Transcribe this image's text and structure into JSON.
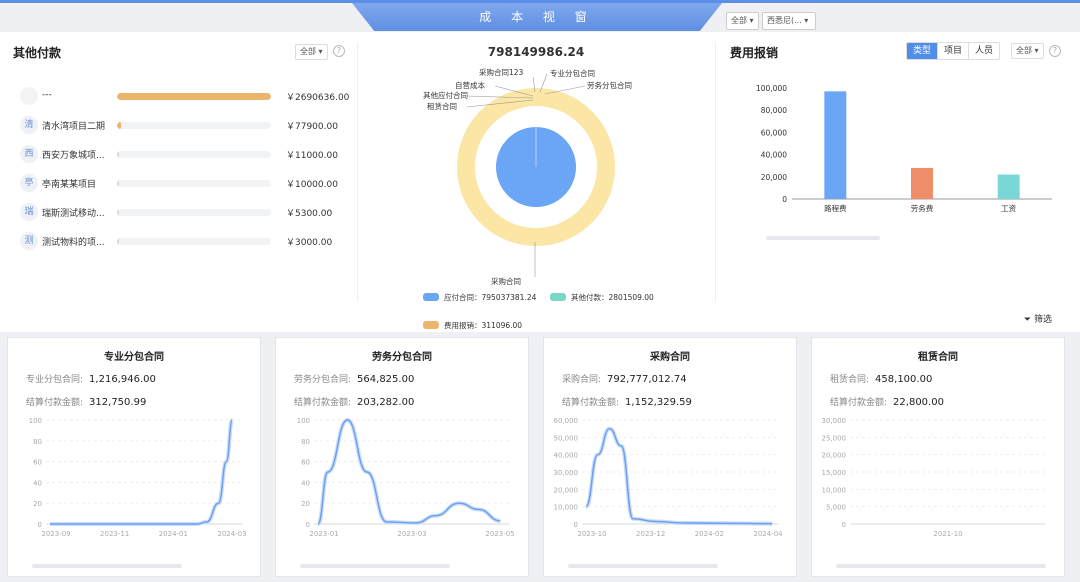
{
  "banner": "成 本 视 窗",
  "top_filters": [
    "全部",
    "西悉尼(..."
  ],
  "other_payments": {
    "title": "其他付款",
    "filter": "全部",
    "items": [
      {
        "initial": "",
        "name": "---",
        "amount": "￥2690636.00",
        "ratio": 1.0
      },
      {
        "initial": "清",
        "name": "清水湾项目二期",
        "amount": "￥77900.00",
        "ratio": 0.029
      },
      {
        "initial": "西",
        "name": "西安万象城项...",
        "amount": "￥11000.00",
        "ratio": 0.004
      },
      {
        "initial": "亭",
        "name": "亭南某某项目",
        "amount": "￥10000.00",
        "ratio": 0.004
      },
      {
        "initial": "瑞",
        "name": "瑞斯测试移动...",
        "amount": "￥5300.00",
        "ratio": 0.002
      },
      {
        "initial": "测",
        "name": "测试物料的项...",
        "amount": "￥3000.00",
        "ratio": 0.001
      }
    ]
  },
  "center": {
    "total": "798149986.24",
    "pie_labels": [
      "采购合同123",
      "专业分包合同",
      "劳务分包合同",
      "自营成本",
      "其他应付合同",
      "租赁合同",
      "采购合同"
    ],
    "legend": [
      {
        "label": "应付合同：795037381.24",
        "color": "#6aa6f5"
      },
      {
        "label": "其他付款：2801509.00",
        "color": "#79d8c4"
      },
      {
        "label": "费用报销：311096.00",
        "color": "#ecb46c"
      }
    ]
  },
  "expense": {
    "title": "费用报销",
    "tabs": [
      "类型",
      "项目",
      "人员"
    ],
    "filter": "全部",
    "chart_data": {
      "type": "bar",
      "categories": [
        "路程费",
        "劳务费",
        "工资"
      ],
      "values": [
        97000,
        28000,
        22000
      ],
      "colors": [
        "#6aa6f5",
        "#ee8d68",
        "#79d8d6"
      ],
      "yticks": [
        "100,000",
        "80,000",
        "60,000",
        "40,000",
        "20,000",
        "0"
      ],
      "ylim": [
        0,
        100000
      ]
    }
  },
  "filter_label": "筛选",
  "cards": [
    {
      "title": "专业分包合同",
      "contract_label": "专业分包合同:",
      "contract_value": "1,216,946.00",
      "settle_label": "结算付款金额:",
      "settle_value": "312,750.99",
      "chart_data": {
        "type": "line",
        "yticks": [
          "100",
          "80",
          "60",
          "40",
          "20",
          "0"
        ],
        "ylim": [
          0,
          100
        ],
        "xticks": [
          "2023-09",
          "2023-11",
          "2024-01",
          "2024-03"
        ],
        "points": [
          [
            0,
            0
          ],
          [
            0.15,
            0
          ],
          [
            0.3,
            0
          ],
          [
            0.45,
            0
          ],
          [
            0.6,
            0
          ],
          [
            0.75,
            0
          ],
          [
            0.8,
            2
          ],
          [
            0.86,
            20
          ],
          [
            0.9,
            60
          ],
          [
            0.93,
            100
          ]
        ]
      }
    },
    {
      "title": "劳务分包合同",
      "contract_label": "劳务分包合同:",
      "contract_value": "564,825.00",
      "settle_label": "结算付款金额:",
      "settle_value": "203,282.00",
      "chart_data": {
        "type": "line",
        "yticks": [
          "100",
          "80",
          "60",
          "40",
          "20",
          "0"
        ],
        "ylim": [
          0,
          100
        ],
        "xticks": [
          "2023-01",
          "2023-03",
          "2023-05"
        ],
        "points": [
          [
            0,
            0
          ],
          [
            0.05,
            50
          ],
          [
            0.15,
            100
          ],
          [
            0.25,
            50
          ],
          [
            0.35,
            2
          ],
          [
            0.5,
            1
          ],
          [
            0.6,
            8
          ],
          [
            0.72,
            20
          ],
          [
            0.82,
            14
          ],
          [
            0.93,
            3
          ]
        ]
      }
    },
    {
      "title": "采购合同",
      "contract_label": "采购合同:",
      "contract_value": "792,777,012.74",
      "settle_label": "结算付款金额:",
      "settle_value": "1,152,329.59",
      "chart_data": {
        "type": "line",
        "yticks": [
          "60,000",
          "50,000",
          "40,000",
          "30,000",
          "20,000",
          "10,000",
          "0"
        ],
        "ylim": [
          0,
          60000
        ],
        "xticks": [
          "2023-10",
          "2023-12",
          "2024-02",
          "2024-04"
        ],
        "points": [
          [
            0,
            10000
          ],
          [
            0.06,
            40000
          ],
          [
            0.12,
            55000
          ],
          [
            0.18,
            45000
          ],
          [
            0.24,
            3000
          ],
          [
            0.35,
            1500
          ],
          [
            0.5,
            600
          ],
          [
            0.7,
            400
          ],
          [
            0.95,
            200
          ]
        ]
      }
    },
    {
      "title": "租赁合同",
      "contract_label": "租赁合同:",
      "contract_value": "458,100.00",
      "settle_label": "结算付款金额:",
      "settle_value": "22,800.00",
      "chart_data": {
        "type": "line",
        "yticks": [
          "30,000",
          "25,000",
          "20,000",
          "15,000",
          "10,000",
          "5,000",
          "0"
        ],
        "ylim": [
          0,
          30000
        ],
        "xticks": [
          "2021-10"
        ],
        "points": []
      }
    }
  ]
}
